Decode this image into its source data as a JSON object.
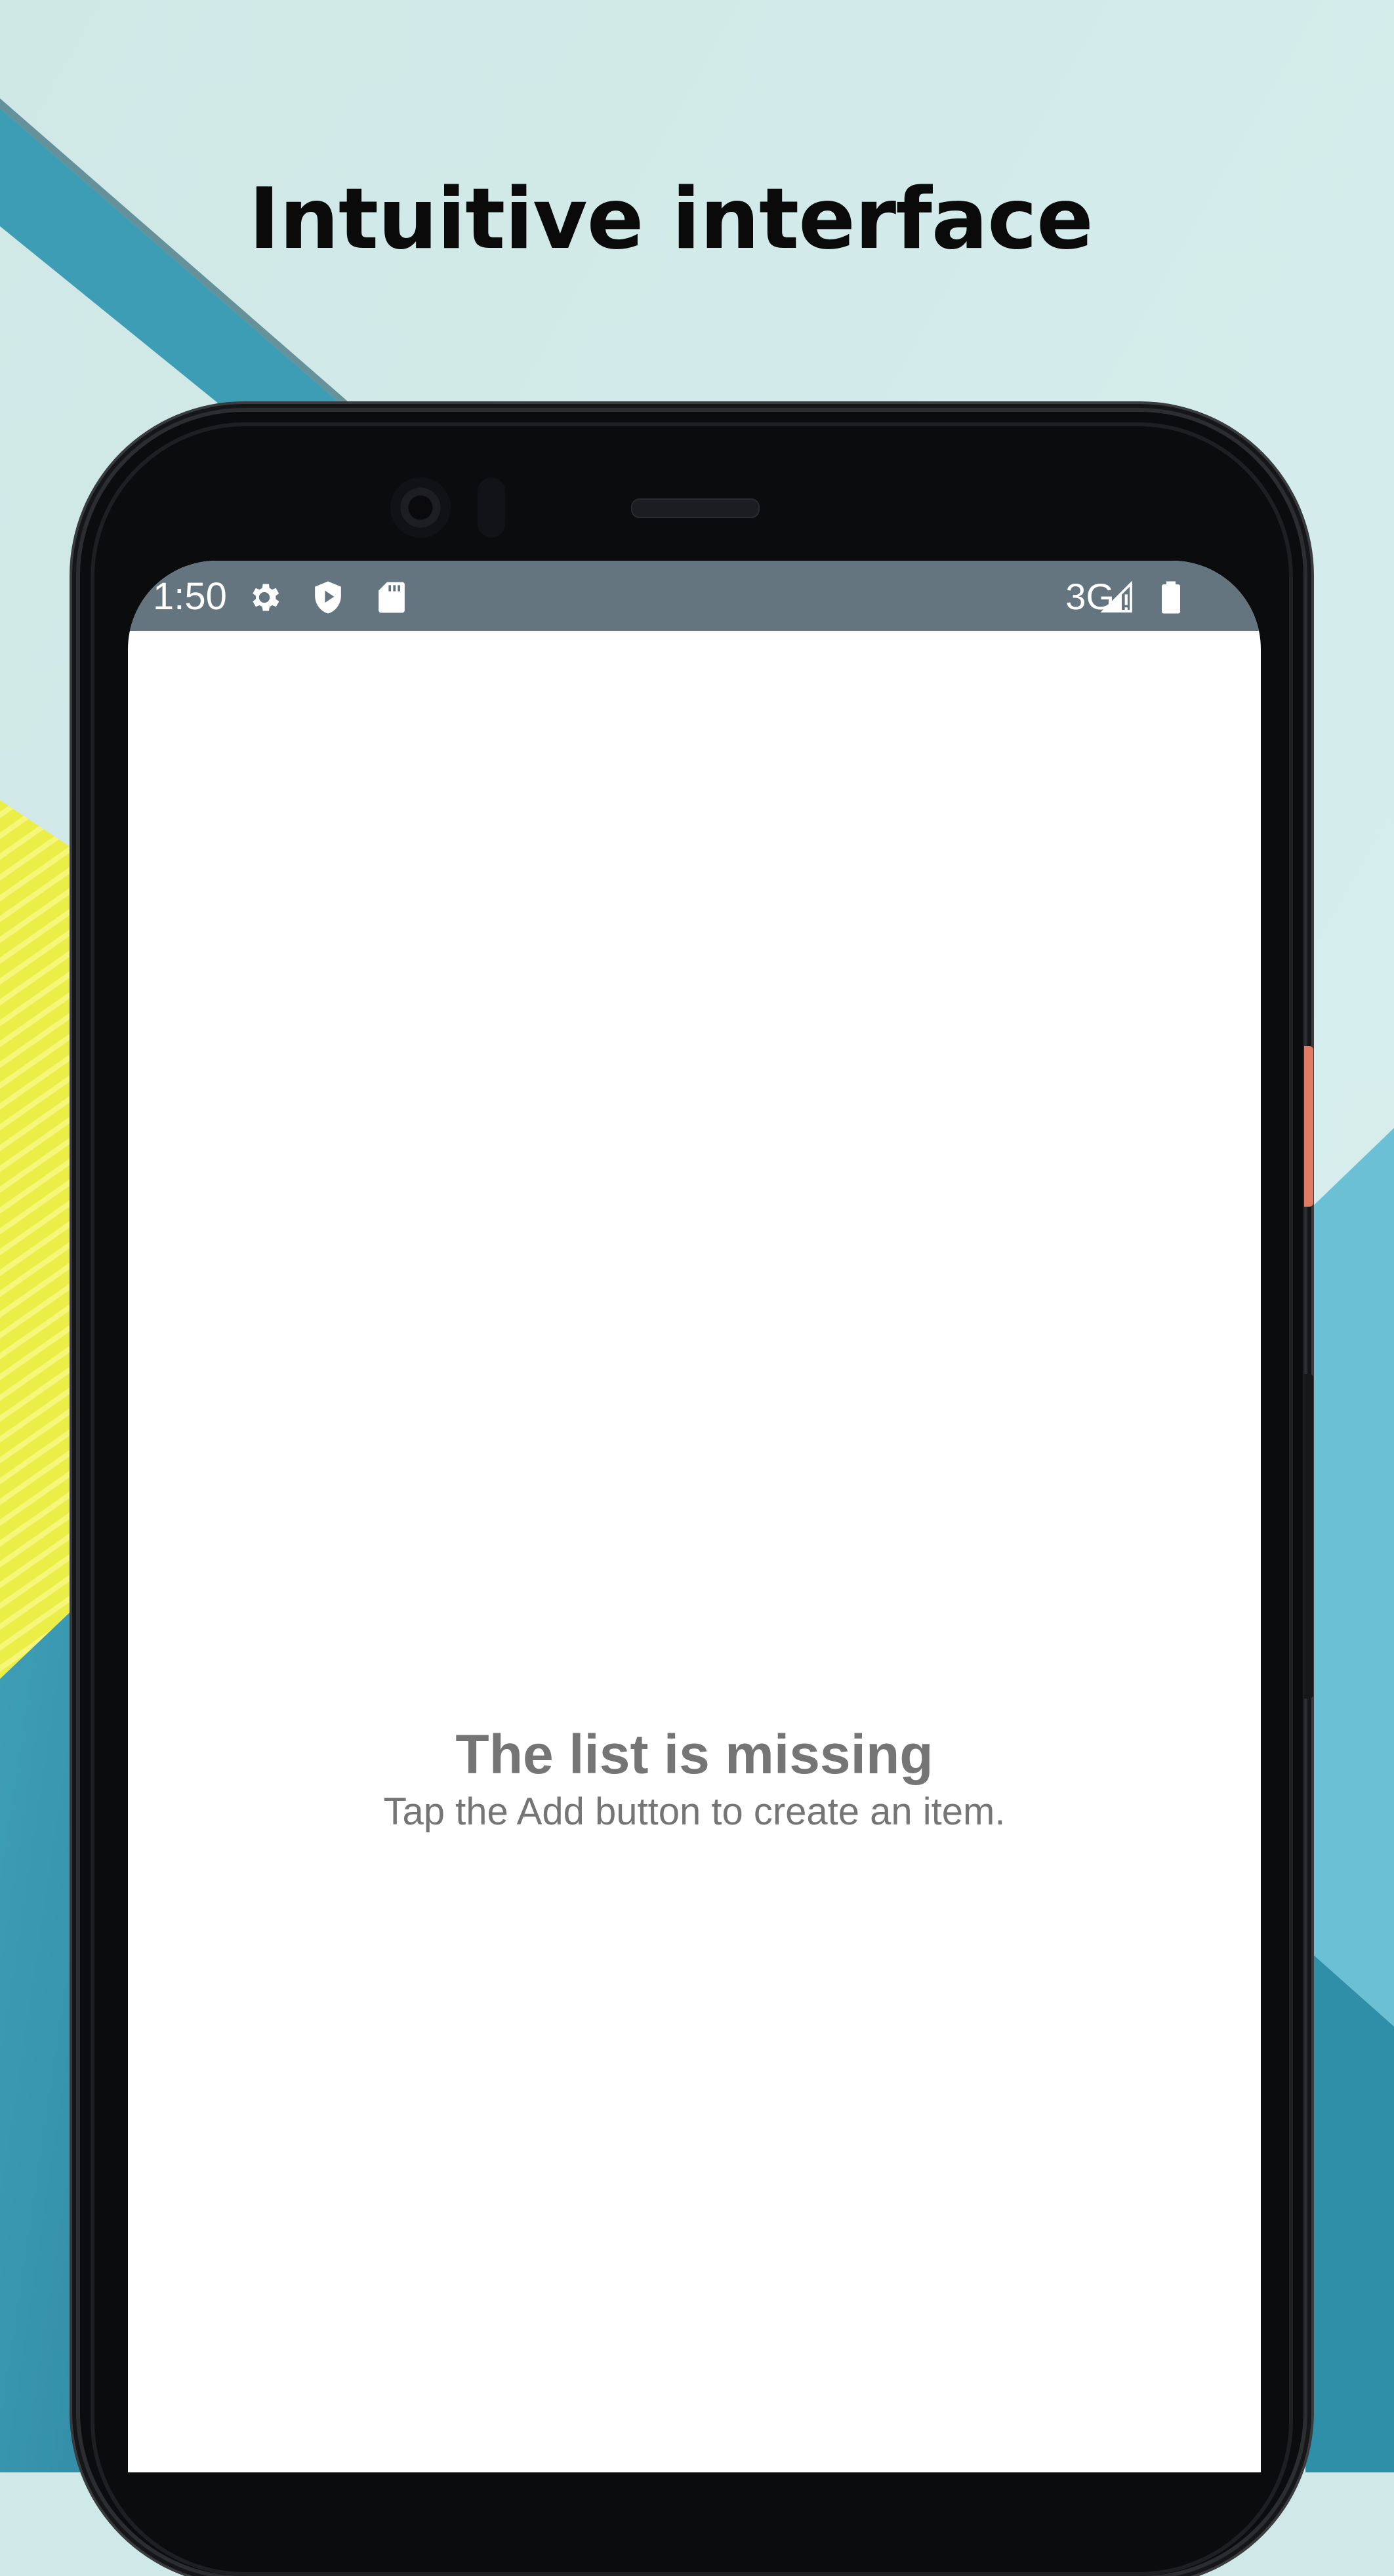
{
  "promo": {
    "title": "Intuitive interface"
  },
  "status_bar": {
    "time": "1:50",
    "left_icons": [
      "gear-icon",
      "shield-play-icon",
      "sd-card-icon"
    ],
    "network": "3G",
    "right_icons": [
      "signal-icon",
      "battery-icon"
    ],
    "background_color": "#64757f"
  },
  "empty_state": {
    "title": "The list is missing",
    "subtitle": "Tap the Add button to create an item."
  },
  "colors": {
    "teal_stripe": "#3fa0b8",
    "yellow_panel": "#eef04c",
    "light_cyan": "#d4ecec",
    "accent_button": "#e07a63"
  }
}
